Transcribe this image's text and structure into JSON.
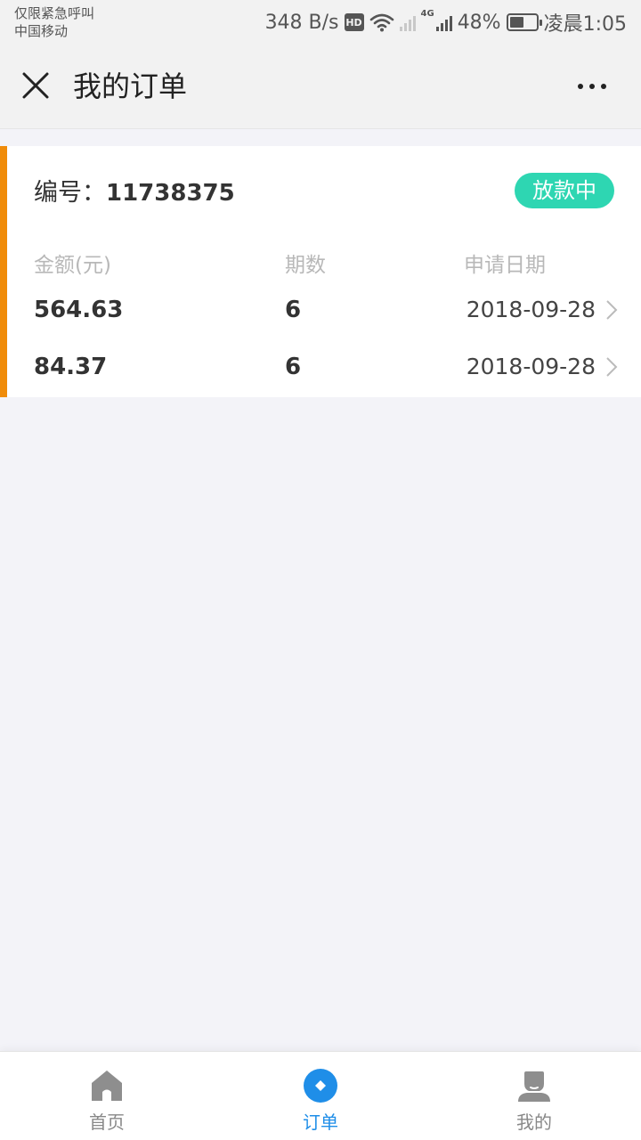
{
  "status_bar": {
    "carrier_line1": "仅限紧急呼叫",
    "carrier_line2": "中国移动",
    "net_speed": "348 B/s",
    "hd_badge": "HD",
    "net_type": "4G",
    "battery": "48%",
    "time": "凌晨1:05"
  },
  "nav": {
    "title": "我的订单"
  },
  "order": {
    "number_label": "编号：",
    "number": "11738375",
    "status": "放款中",
    "columns": [
      "金额(元)",
      "期数",
      "申请日期"
    ],
    "rows": [
      {
        "amount": "564.63",
        "periods": "6",
        "date": "2018-09-28"
      },
      {
        "amount": "84.37",
        "periods": "6",
        "date": "2018-09-28"
      }
    ]
  },
  "tabs": [
    {
      "label": "首页",
      "icon": "home-icon"
    },
    {
      "label": "订单",
      "icon": "order-icon"
    },
    {
      "label": "我的",
      "icon": "user-icon"
    }
  ],
  "colors": {
    "accent_orange": "#f08c0a",
    "status_teal": "#2ed6b2",
    "active_blue": "#1f8ee8",
    "inactive_gray": "#999999"
  },
  "active_tab": 1
}
